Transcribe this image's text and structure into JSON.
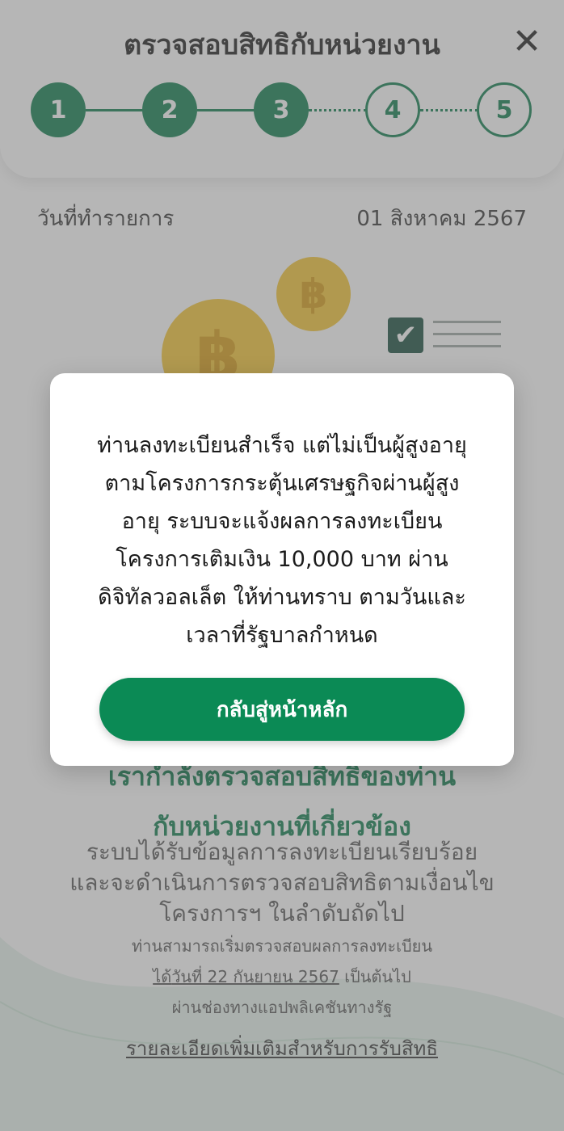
{
  "header": {
    "title": "ตรวจสอบสิทธิกับหน่วยงาน",
    "close_label": "✕",
    "steps": [
      "1",
      "2",
      "3",
      "4",
      "5"
    ],
    "current_step": 3
  },
  "transaction": {
    "date_label": "วันที่ทำรายการ",
    "date_value": "01 สิงหาคม 2567"
  },
  "illustration": {
    "coin_symbol": "฿",
    "check_symbol": "✔"
  },
  "result": {
    "heading_line1": "เรากำลังตรวจสอบสิทธิของท่าน",
    "heading_line2": "กับหน่วยงานที่เกี่ยวข้อง",
    "body_line1": "ระบบได้รับข้อมูลการลงทะเบียนเรียบร้อย",
    "body_line2": "และจะดำเนินการตรวจสอบสิทธิตามเงื่อนไข",
    "body_line3": "โครงการฯ ในลำดับถัดไป",
    "note_line1": "ท่านสามารถเริ่มตรวจสอบผลการลงทะเบียน",
    "note_prefix": "ได้",
    "note_date": "วันที่ 22 กันยายน 2567",
    "note_suffix": " เป็นต้นไป",
    "note_line3": "ผ่านช่องทางแอปพลิเคชันทางรัฐ",
    "more_link": "รายละเอียดเพิ่มเติมสำหรับการรับสิทธิ"
  },
  "modal": {
    "line1": "ท่านลงทะเบียนสำเร็จ แต่ไม่เป็นผู้สูงอายุ",
    "line2": "ตามโครงการกระตุ้นเศรษฐกิจผ่านผู้สูง",
    "line3": "อายุ ระบบจะแจ้งผลการลงทะเบียน",
    "line4": "โครงการเติมเงิน 10,000 บาท ผ่าน",
    "line5": "ดิจิทัลวอลเล็ต ให้ท่านทราบ ตามวันและ",
    "line6": "เวลาที่รัฐบาลกำหนด",
    "button_label": "กลับสู่หน้าหลัก"
  },
  "colors": {
    "accent": "#0b7a4a",
    "button": "#0b8a55",
    "coin": "#f4c430"
  }
}
